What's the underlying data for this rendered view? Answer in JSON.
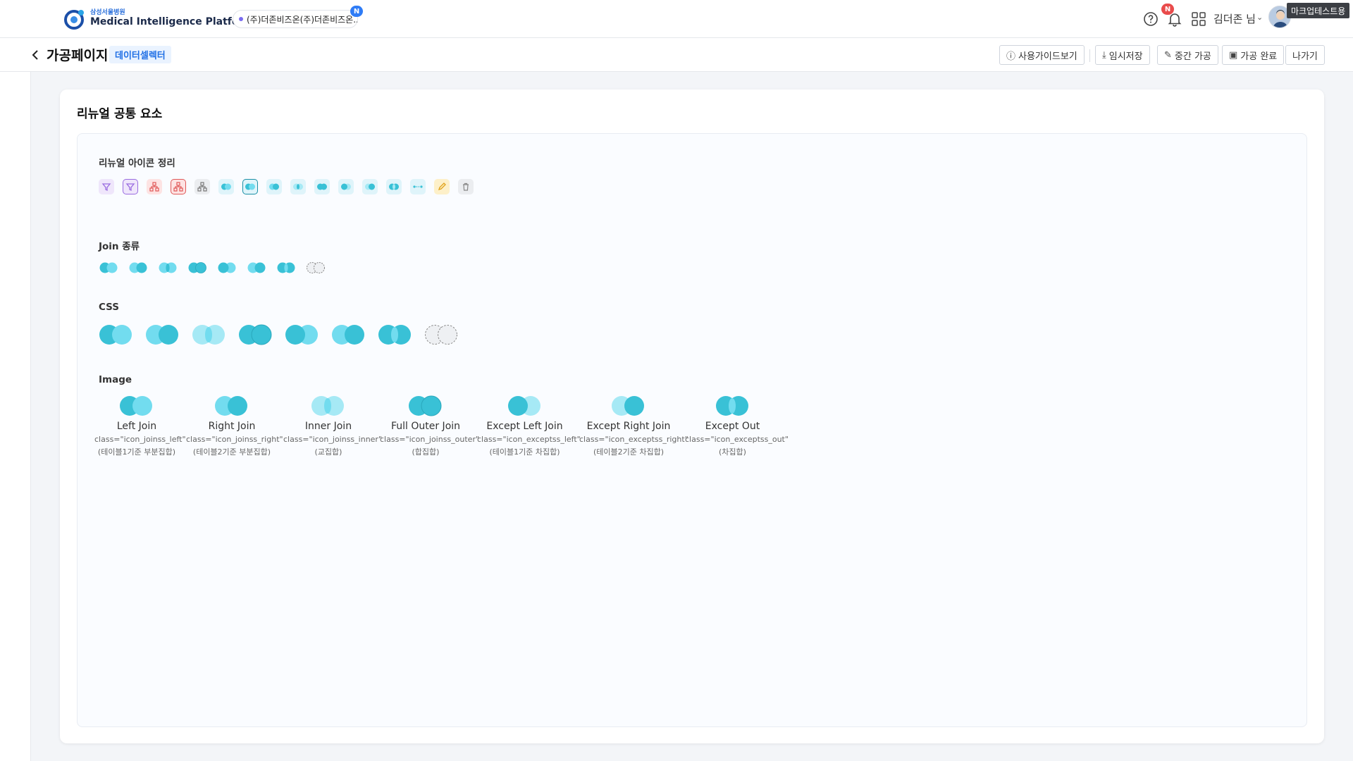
{
  "header": {
    "logo_sub": "삼성서울병원",
    "logo_main": "Medical Intelligence Platform",
    "org_name": "(주)더존비즈온(주)더존비즈온...",
    "org_badge": "N",
    "notif_badge": "N",
    "user_name": "김더존 님",
    "user_tag": "마크업테스트용",
    "icons": [
      "help-icon",
      "bell-icon",
      "apps-grid-icon",
      "chevron-down-icon"
    ]
  },
  "subheader": {
    "title": "가공페이지",
    "chip": "데이터셀렉터",
    "buttons": {
      "guide": "사용가이드보기",
      "temp_save": "임시저장",
      "mid_process": "중간 가공",
      "process_done": "가공 완료",
      "exit": "나가기"
    }
  },
  "card": {
    "title": "리뉴얼 공통 요소",
    "sections": {
      "icons": "리뉴얼 아이콘 정리",
      "join_types": "Join 종류",
      "css": "CSS",
      "image": "Image"
    }
  },
  "icon_list": [
    "filter-icon",
    "filter-outline-icon",
    "hierarchy-red-icon",
    "hierarchy-red-outline-icon",
    "hierarchy-gray-icon",
    "join-left-icon",
    "join-left-selected-icon",
    "join-right-icon",
    "join-inner-icon",
    "join-outer-icon",
    "join-except-left-icon",
    "join-except-right-icon",
    "join-except-out-icon",
    "link-icon",
    "edit-pencil-icon",
    "trash-icon"
  ],
  "join_images": [
    {
      "name": "Left Join",
      "class": "class=\"icon_joinss_left\"",
      "desc": "(테이블1기준 부분집합)"
    },
    {
      "name": "Right Join",
      "class": "class=\"icon_joinss_right\"",
      "desc": "(테이블2기준 부분집합)"
    },
    {
      "name": "Inner Join",
      "class": "class=\"icon_joinss_inner\"",
      "desc": "(교집합)"
    },
    {
      "name": "Full Outer Join",
      "class": "class=\"icon_joinss_outer\"",
      "desc": "(합집합)"
    },
    {
      "name": "Except Left Join",
      "class": "class=\"icon_exceptss_left\"",
      "desc": "(테이블1기준 차집합)"
    },
    {
      "name": "Except Right Join",
      "class": "class=\"icon_exceptss_right\"",
      "desc": "(테이블2기준 차집합)"
    },
    {
      "name": "Except Out",
      "class": "class=\"icon_exceptss_out\"",
      "desc": "(차집합)"
    }
  ],
  "colors": {
    "join_dark": "#39c1d6",
    "join_light": "#72dcef",
    "accent_blue": "#1f6fe5",
    "badge_red": "#e94b4b"
  }
}
